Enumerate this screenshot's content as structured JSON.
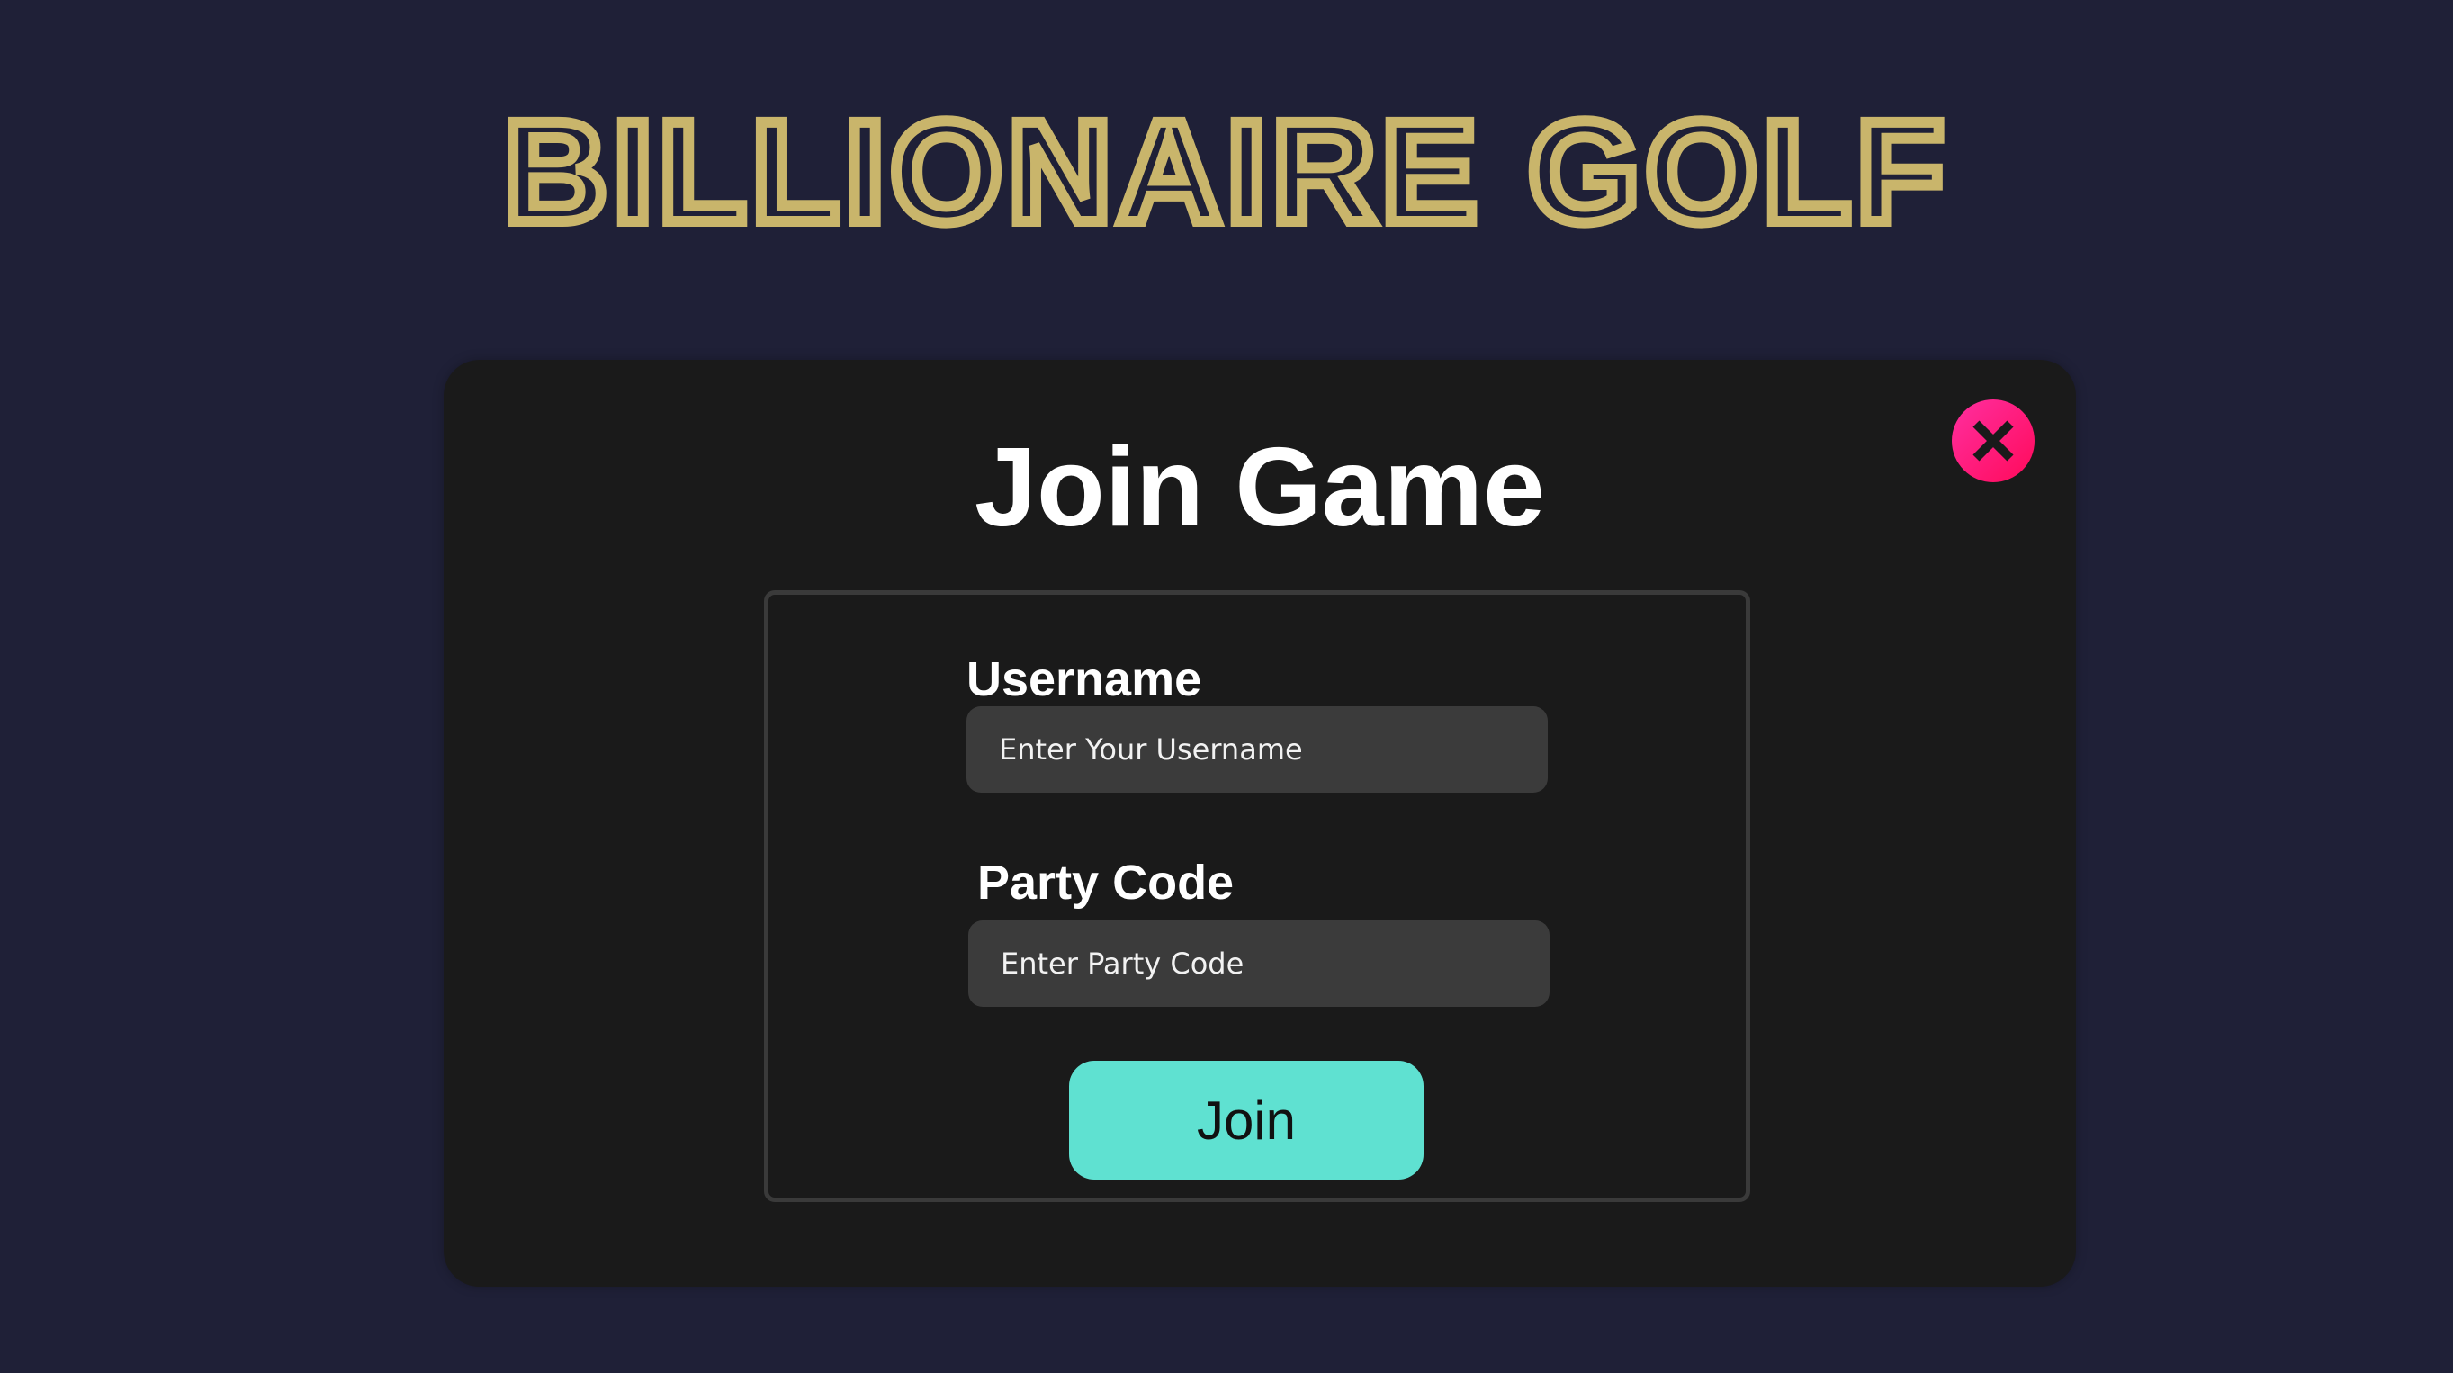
{
  "app": {
    "title": "BILLIONAIRE GOLF"
  },
  "modal": {
    "title": "Join Game",
    "close_icon": "close-x-icon",
    "form": {
      "username_label": "Username",
      "username_placeholder": "Enter Your Username",
      "username_value": "",
      "party_code_label": "Party Code",
      "party_code_placeholder": "Enter Party Code",
      "party_code_value": "",
      "join_label": "Join"
    }
  },
  "colors": {
    "background": "#1f2037",
    "title_gold": "#c9b56b",
    "modal_bg": "#1a1a1a",
    "input_bg": "#3b3b3b",
    "join_button": "#5fe1d1",
    "close_button": "#ff1f7a"
  }
}
